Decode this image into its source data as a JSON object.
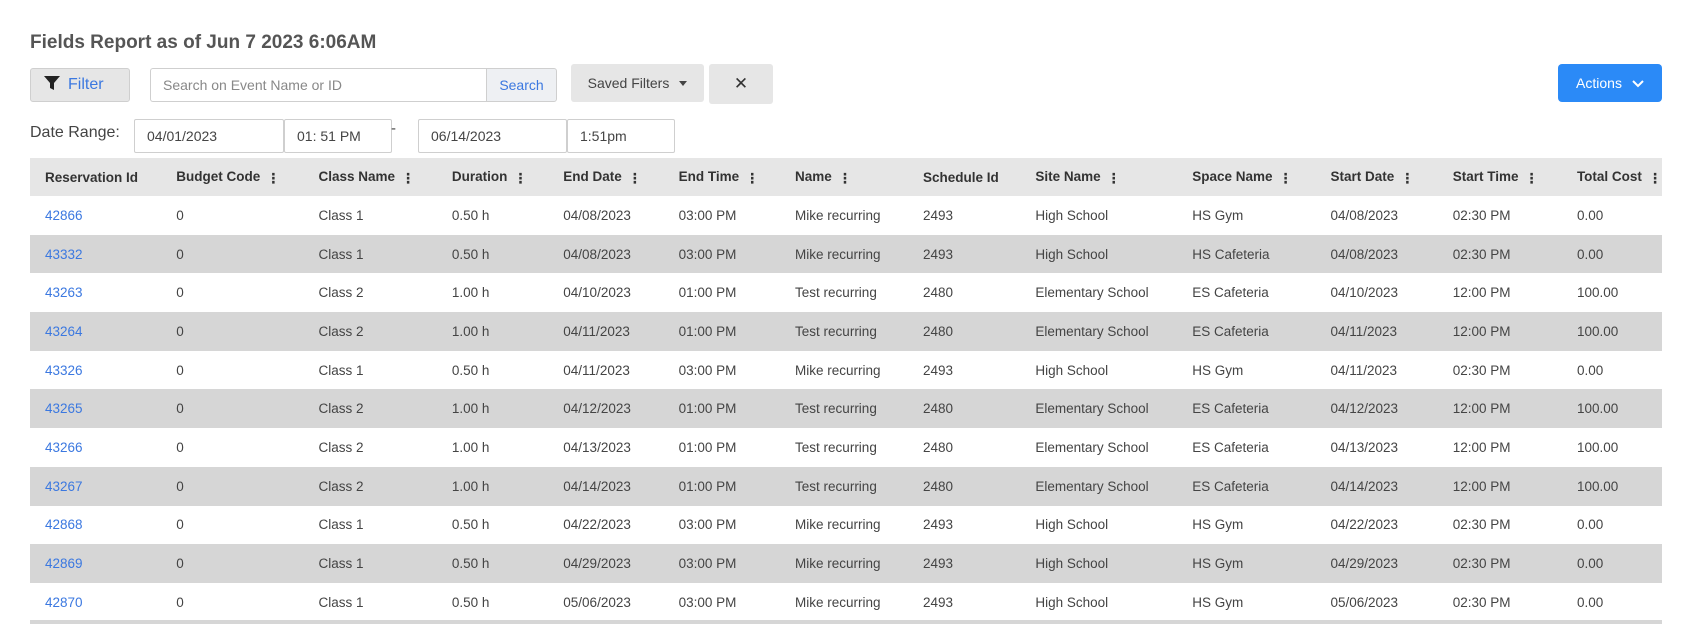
{
  "page": {
    "title": "Fields Report as of Jun 7 2023 6:06AM"
  },
  "toolbar": {
    "filter_label": "Filter",
    "search_placeholder": "Search on Event Name or ID",
    "search_button": "Search",
    "saved_filters_label": "Saved Filters",
    "clear_label": "✕",
    "actions_label": "Actions"
  },
  "date_range": {
    "label": "Date Range:",
    "start_date": "04/01/2023",
    "start_time": "01: 51 PM",
    "separator": "-",
    "end_date": "06/14/2023",
    "end_time": "1:51pm"
  },
  "table": {
    "columns": [
      {
        "label": "Reservation Id",
        "menu": false
      },
      {
        "label": "Budget Code",
        "menu": true
      },
      {
        "label": "Class Name",
        "menu": true
      },
      {
        "label": "Duration",
        "menu": true
      },
      {
        "label": "End Date",
        "menu": true
      },
      {
        "label": "End Time",
        "menu": true
      },
      {
        "label": "Name",
        "menu": true
      },
      {
        "label": "Schedule Id",
        "menu": false
      },
      {
        "label": "Site Name",
        "menu": true
      },
      {
        "label": "Space Name",
        "menu": true
      },
      {
        "label": "Start Date",
        "menu": true
      },
      {
        "label": "Start Time",
        "menu": true
      },
      {
        "label": "Total Cost",
        "menu": true
      }
    ],
    "rows": [
      [
        "42866",
        "0",
        "Class 1",
        "0.50 h",
        "04/08/2023",
        "03:00 PM",
        "Mike recurring",
        "2493",
        "High School",
        "HS Gym",
        "04/08/2023",
        "02:30 PM",
        "0.00"
      ],
      [
        "43332",
        "0",
        "Class 1",
        "0.50 h",
        "04/08/2023",
        "03:00 PM",
        "Mike recurring",
        "2493",
        "High School",
        "HS Cafeteria",
        "04/08/2023",
        "02:30 PM",
        "0.00"
      ],
      [
        "43263",
        "0",
        "Class 2",
        "1.00 h",
        "04/10/2023",
        "01:00 PM",
        "Test recurring",
        "2480",
        "Elementary School",
        "ES Cafeteria",
        "04/10/2023",
        "12:00 PM",
        "100.00"
      ],
      [
        "43264",
        "0",
        "Class 2",
        "1.00 h",
        "04/11/2023",
        "01:00 PM",
        "Test recurring",
        "2480",
        "Elementary School",
        "ES Cafeteria",
        "04/11/2023",
        "12:00 PM",
        "100.00"
      ],
      [
        "43326",
        "0",
        "Class 1",
        "0.50 h",
        "04/11/2023",
        "03:00 PM",
        "Mike recurring",
        "2493",
        "High School",
        "HS Gym",
        "04/11/2023",
        "02:30 PM",
        "0.00"
      ],
      [
        "43265",
        "0",
        "Class 2",
        "1.00 h",
        "04/12/2023",
        "01:00 PM",
        "Test recurring",
        "2480",
        "Elementary School",
        "ES Cafeteria",
        "04/12/2023",
        "12:00 PM",
        "100.00"
      ],
      [
        "43266",
        "0",
        "Class 2",
        "1.00 h",
        "04/13/2023",
        "01:00 PM",
        "Test recurring",
        "2480",
        "Elementary School",
        "ES Cafeteria",
        "04/13/2023",
        "12:00 PM",
        "100.00"
      ],
      [
        "43267",
        "0",
        "Class 2",
        "1.00 h",
        "04/14/2023",
        "01:00 PM",
        "Test recurring",
        "2480",
        "Elementary School",
        "ES Cafeteria",
        "04/14/2023",
        "12:00 PM",
        "100.00"
      ],
      [
        "42868",
        "0",
        "Class 1",
        "0.50 h",
        "04/22/2023",
        "03:00 PM",
        "Mike recurring",
        "2493",
        "High School",
        "HS Gym",
        "04/22/2023",
        "02:30 PM",
        "0.00"
      ],
      [
        "42869",
        "0",
        "Class 1",
        "0.50 h",
        "04/29/2023",
        "03:00 PM",
        "Mike recurring",
        "2493",
        "High School",
        "HS Gym",
        "04/29/2023",
        "02:30 PM",
        "0.00"
      ],
      [
        "42870",
        "0",
        "Class 1",
        "0.50 h",
        "05/06/2023",
        "03:00 PM",
        "Mike recurring",
        "2493",
        "High School",
        "HS Gym",
        "05/06/2023",
        "02:30 PM",
        "0.00"
      ]
    ]
  },
  "colors": {
    "link": "#3b78e0",
    "actions_bg": "#2b8af7",
    "row_alt": "#d6d6d6",
    "header_bg": "#e6e6e6"
  }
}
